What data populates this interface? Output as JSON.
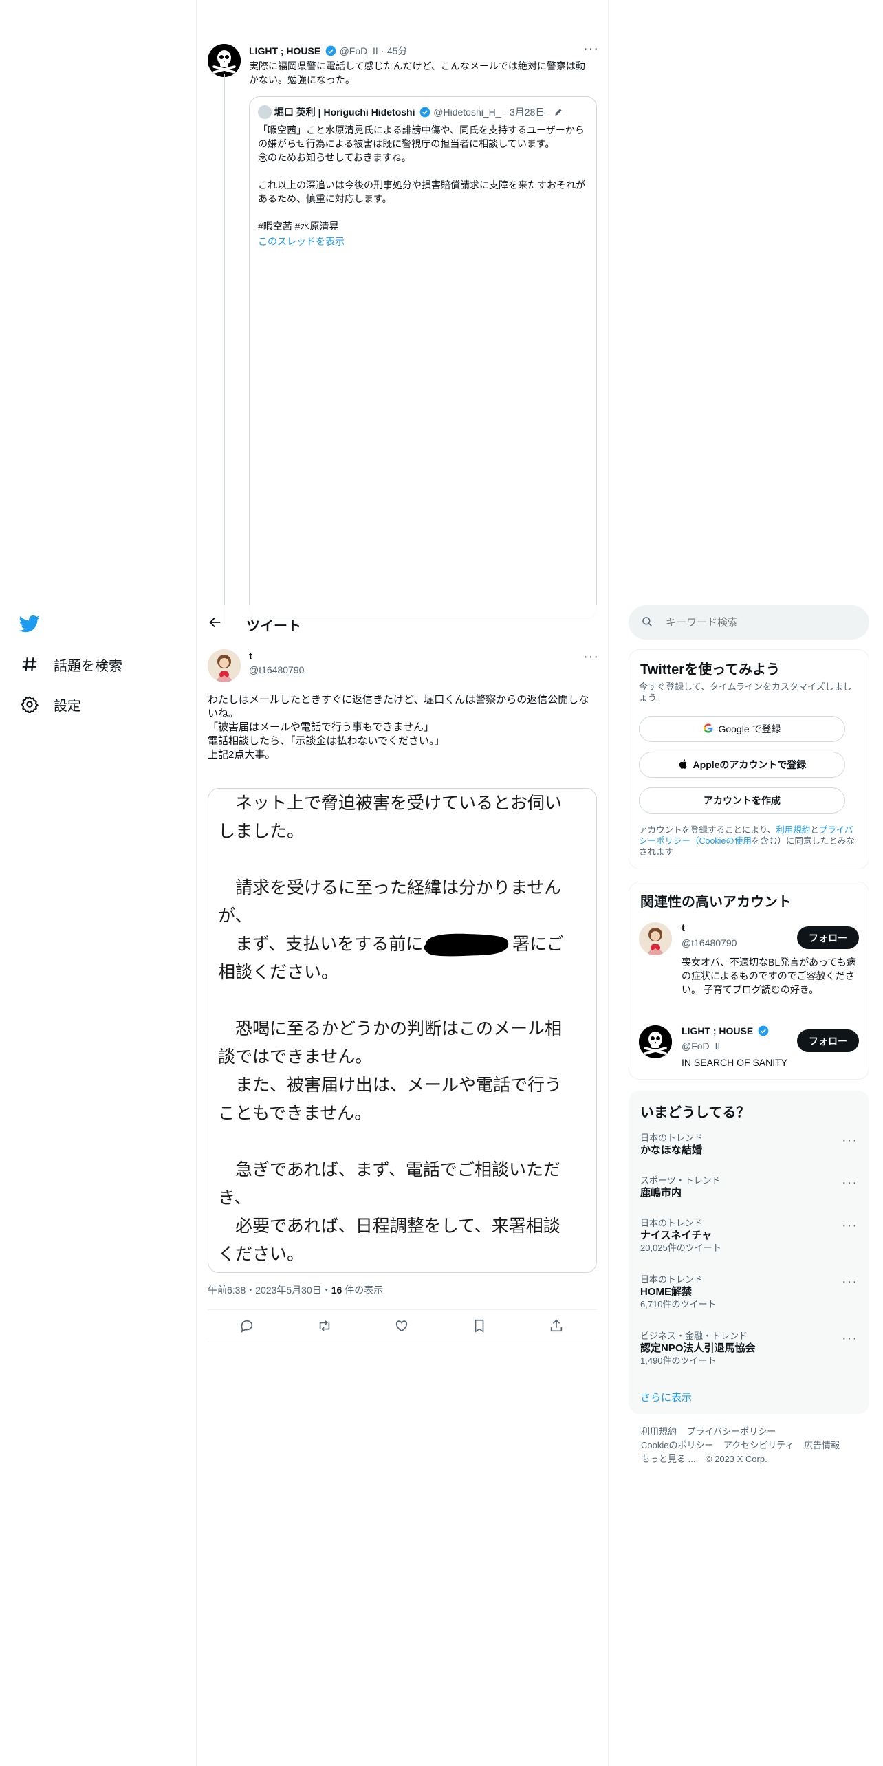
{
  "nav": {
    "explore_label": "話題を検索",
    "settings_label": "設定"
  },
  "header": {
    "title": "ツイート"
  },
  "top_tweet": {
    "name": "LIGHT ; HOUSE",
    "handle": "@FoD_II",
    "time": "45分",
    "text": "実際に福岡県警に電話して感じたんだけど、こんなメールでは絶対に警察は動かない。勉強になった。",
    "quote": {
      "name": "堀口 英利 | Horiguchi Hidetoshi",
      "handle": "@Hidetoshi_H_",
      "date": "3月28日",
      "text": "「暇空茜」こと水原清晃氏による誹謗中傷や、同氏を支持するユーザーからの嫌がらせ行為による被害は既に警視庁の担当者に相談しています。\n念のためお知らせしておきますね。\n\nこれ以上の深追いは今後の刑事処分や損害賠償請求に支障を来たすおそれがあるため、慎重に対応します。",
      "hashtags": "#暇空茜 #水原清晃",
      "show_thread": "このスレッドを表示"
    }
  },
  "main_tweet": {
    "name": "t",
    "handle": "@t16480790",
    "text": "わたしはメールしたときすぐに返信きたけど、堀口くんは警察からの返信公開しないね。\n「被害届はメールや電話で行う事もできません」\n電話相談したら、「示談金は払わないでください。」\n上記2点大事。",
    "image_text_1": "　ネット上で脅迫被害を受けているとお伺いしました。\n\n　請求を受けるに至った経緯は分かりませんが、\n　まず、支払いをする前に",
    "image_text_2": "署にご相談ください。\n\n　恐喝に至るかどうかの判断はこのメール相談ではできません。\n　また、被害届け出は、メールや電話で行うこともできません。\n\n　急ぎであれば、まず、電話でご相談いただき、\n　必要であれば、日程調整をして、来署相談ください。",
    "meta_time": "午前6:38・2023年5月30日・",
    "views_count": "16",
    "views_label": " 件の表示"
  },
  "search": {
    "placeholder": "キーワード検索"
  },
  "signup_card": {
    "title": "Twitterを使ってみよう",
    "subtitle": "今すぐ登録して、タイムラインをカスタマイズしましょう。",
    "google_label": "Google で登録",
    "apple_label": "Appleのアカウントで登録",
    "create_label": "アカウントを作成",
    "legal_prefix": "アカウントを登録することにより、",
    "legal_terms": "利用規約",
    "legal_and": "と",
    "legal_privacy": "プライバシーポリシー（Cookieの使用",
    "legal_suffix": "を含む）に同意したとみなされます。"
  },
  "related_card": {
    "title": "関連性の高いアカウント",
    "accounts": [
      {
        "name": "t",
        "handle": "@t16480790",
        "bio": "喪女オバ、不適切なBL発言があっても病の症状によるものですのでご容赦ください。 子育てブログ読むの好き。",
        "follow_label": "フォロー"
      },
      {
        "name": "LIGHT ; HOUSE",
        "handle": "@FoD_II",
        "bio": "IN SEARCH OF SANITY",
        "follow_label": "フォロー"
      }
    ]
  },
  "trends_card": {
    "title": "いまどうしてる？",
    "items": [
      {
        "category": "日本のトレンド",
        "name": "かなほな結婚",
        "count": ""
      },
      {
        "category": "スポーツ・トレンド",
        "name": "鹿嶋市内",
        "count": ""
      },
      {
        "category": "日本のトレンド",
        "name": "ナイスネイチャ",
        "count": "20,025件のツイート"
      },
      {
        "category": "日本のトレンド",
        "name": "HOME解禁",
        "count": "6,710件のツイート"
      },
      {
        "category": "ビジネス・金融・トレンド",
        "name": "認定NPO法人引退馬協会",
        "count": "1,490件のツイート"
      }
    ],
    "show_more": "さらに表示"
  },
  "footer": {
    "terms": "利用規約",
    "privacy": "プライバシーポリシー",
    "cookie": "Cookieのポリシー",
    "accessibility": "アクセシビリティ",
    "ads": "広告情報",
    "more": "もっと見る ...",
    "copyright": "© 2023 X Corp."
  },
  "colors": {
    "accent": "#1d9bf0",
    "text": "#0f1419",
    "muted": "#536471",
    "border": "#cfd9de"
  }
}
